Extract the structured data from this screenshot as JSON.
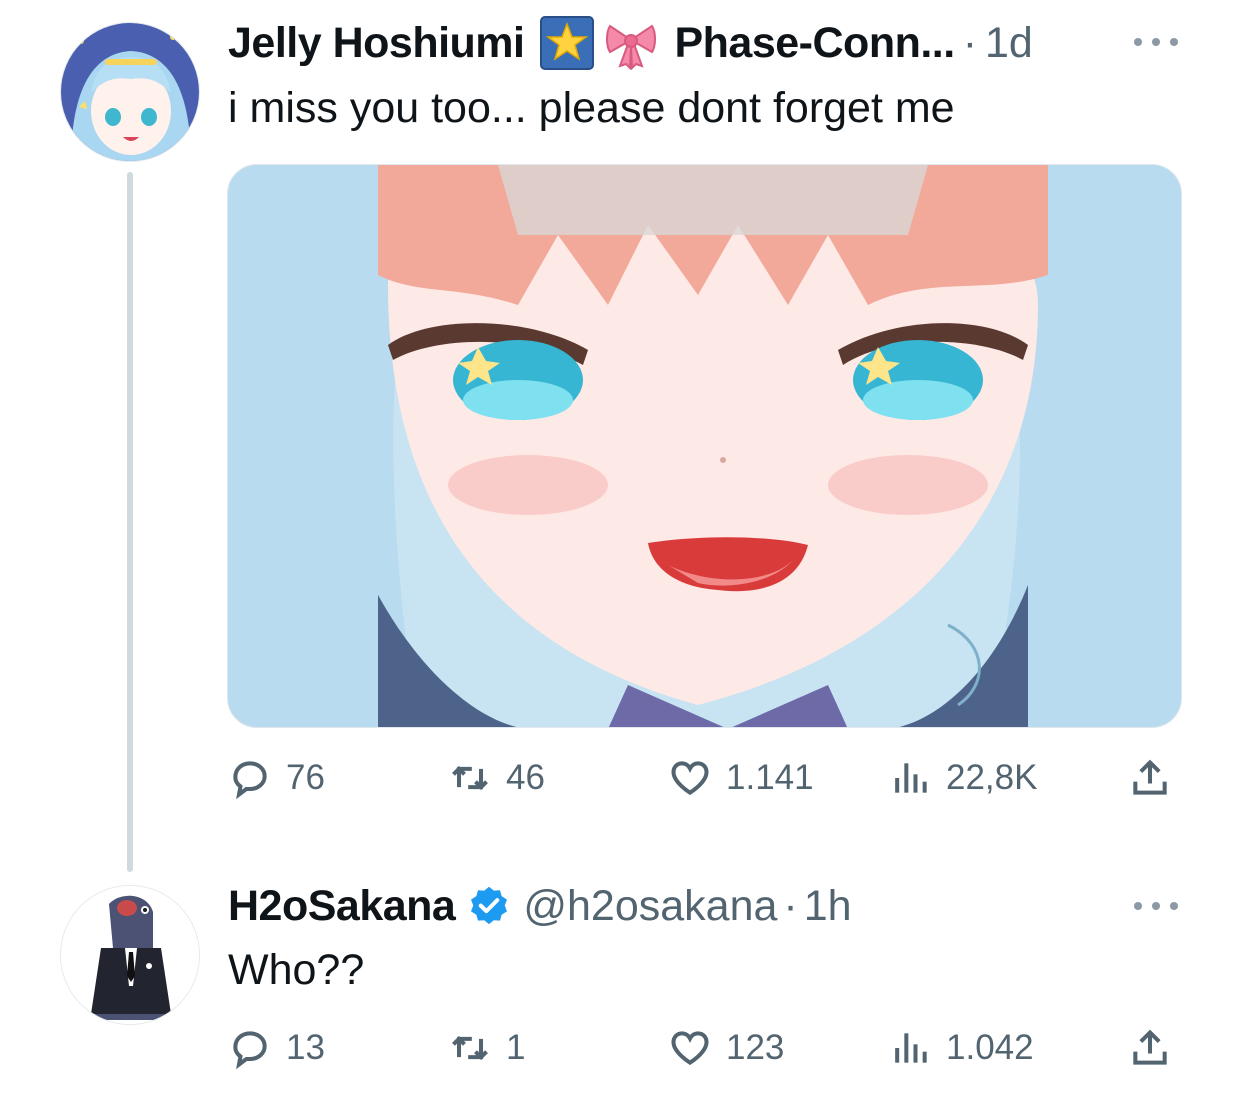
{
  "tweet1": {
    "display_name": "Jelly Hoshiumi",
    "emoji_icons": [
      "star-badge-icon",
      "bow-icon"
    ],
    "secondary_name": "Phase-Conn...",
    "separator": "·",
    "time": "1d",
    "text": "i miss you too... please dont forget me",
    "stats": {
      "replies": "76",
      "retweets": "46",
      "likes": "1.141",
      "views": "22,8K"
    }
  },
  "tweet2": {
    "display_name": "H2oSakana",
    "verified": true,
    "handle": "@h2osakana",
    "separator": "·",
    "time": "1h",
    "text": "Who??",
    "stats": {
      "replies": "13",
      "retweets": "1",
      "likes": "123",
      "views": "1.042"
    }
  },
  "colors": {
    "text_primary": "#0f1419",
    "text_secondary": "#536471",
    "verified_blue": "#1d9bf0",
    "thread_line": "#cfd9de"
  }
}
